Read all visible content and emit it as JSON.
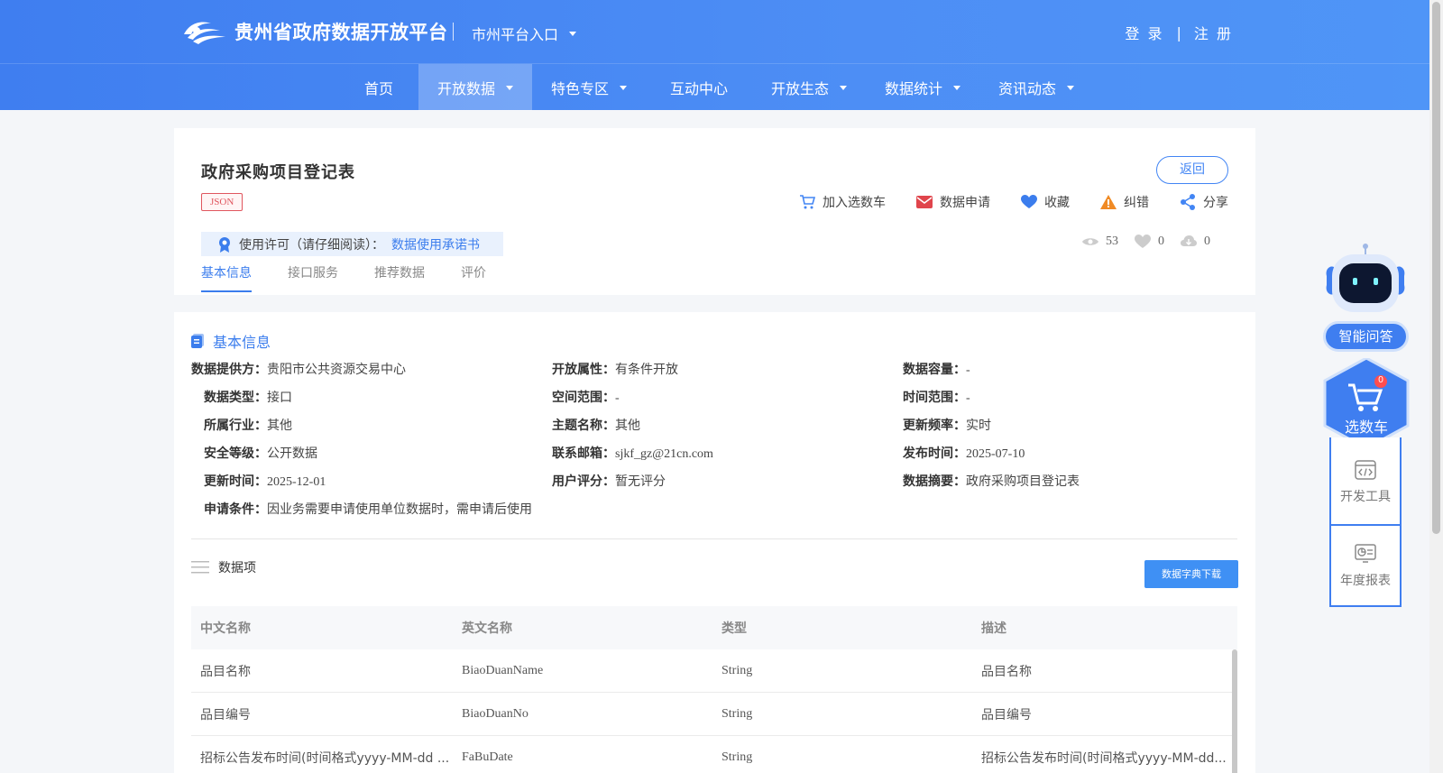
{
  "header": {
    "site_title": "贵州省政府数据开放平台",
    "city_entry": "市州平台入口",
    "login": "登 录",
    "separator": "|",
    "register": "注 册"
  },
  "nav": {
    "items": [
      {
        "label": "首页",
        "dropdown": false
      },
      {
        "label": "开放数据",
        "dropdown": true,
        "active": true
      },
      {
        "label": "特色专区",
        "dropdown": true
      },
      {
        "label": "互动中心",
        "dropdown": false
      },
      {
        "label": "开放生态",
        "dropdown": true
      },
      {
        "label": "数据统计",
        "dropdown": true
      },
      {
        "label": "资讯动态",
        "dropdown": true
      }
    ]
  },
  "dataset": {
    "title": "政府采购项目登记表",
    "format_badge": "JSON",
    "back_label": "返回",
    "actions": {
      "cart": "加入选数车",
      "apply": "数据申请",
      "favorite": "收藏",
      "report": "纠错",
      "share": "分享"
    },
    "license_label": "使用许可（请仔细阅读）：",
    "license_link": "数据使用承诺书",
    "stats": {
      "views": "53",
      "likes": "0",
      "downloads": "0"
    },
    "tabs": [
      "基本信息",
      "接口服务",
      "推荐数据",
      "评价"
    ]
  },
  "basic_info": {
    "section_title": "基本信息",
    "rows": [
      [
        {
          "label": "数据提供方：",
          "value": "贵阳市公共资源交易中心"
        },
        {
          "label": "开放属性：",
          "value": "有条件开放"
        },
        {
          "label": "数据容量：",
          "value": "-"
        }
      ],
      [
        {
          "label": "数据类型：",
          "value": "接口"
        },
        {
          "label": "空间范围：",
          "value": "-"
        },
        {
          "label": "时间范围：",
          "value": "-"
        }
      ],
      [
        {
          "label": "所属行业：",
          "value": "其他"
        },
        {
          "label": "主题名称：",
          "value": "其他"
        },
        {
          "label": "更新频率：",
          "value": "实时"
        }
      ],
      [
        {
          "label": "安全等级：",
          "value": "公开数据"
        },
        {
          "label": "联系邮箱：",
          "value": "sjkf_gz@21cn.com"
        },
        {
          "label": "发布时间：",
          "value": "2025-07-10"
        }
      ],
      [
        {
          "label": "更新时间：",
          "value": "2025-12-01"
        },
        {
          "label": "用户评分：",
          "value": "暂无评分"
        },
        {
          "label": "数据摘要：",
          "value": "政府采购项目登记表"
        }
      ],
      [
        {
          "label": "申请条件：",
          "value": "因业务需要申请使用单位数据时，需申请后使用"
        }
      ]
    ]
  },
  "data_items": {
    "title": "数据项",
    "download_label": "数据字典下载",
    "columns": [
      "中文名称",
      "英文名称",
      "类型",
      "描述"
    ],
    "rows": [
      [
        "品目名称",
        "BiaoDuanName",
        "String",
        "品目名称"
      ],
      [
        "品目编号",
        "BiaoDuanNo",
        "String",
        "品目编号"
      ],
      [
        "招标公告发布时间(时间格式yyyy-MM-dd ...",
        "FaBuDate",
        "String",
        "招标公告发布时间(时间格式yyyy-MM-dd..."
      ]
    ]
  },
  "sidebar": {
    "qa_label": "智能问答",
    "cart_label": "选数车",
    "cart_count": "0",
    "dev_tools": "开发工具",
    "annual_report": "年度报表"
  },
  "colors": {
    "brand_blue": "#3f7ef0",
    "link_blue": "#3b7ded",
    "badge_red": "#e0565e",
    "button_blue": "#3f90f4"
  }
}
